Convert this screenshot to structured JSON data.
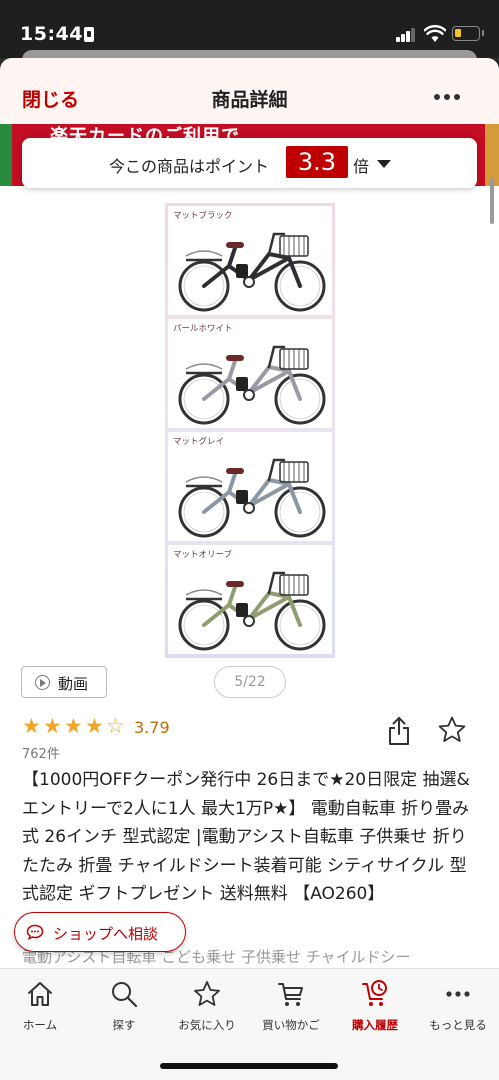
{
  "status_bar": {
    "time": "15:44"
  },
  "header": {
    "close_label": "閉じる",
    "title": "商品詳細"
  },
  "banner": {
    "text": "楽天カードのご利用で"
  },
  "point": {
    "text": "今この商品はポイント",
    "multiplier": "3.3",
    "unit": "倍"
  },
  "gallery": {
    "variants": [
      "マットブラック",
      "パールホワイト",
      "マットグレイ",
      "マットオリーブ"
    ],
    "variant_colors": [
      "#2d2e33",
      "#e8e8ec",
      "#8b98a3",
      "#8f9e6e"
    ],
    "video_label": "動画",
    "pager": "5/22"
  },
  "rating": {
    "value": "3.79",
    "stars": 4,
    "max": 5,
    "count": "762件"
  },
  "product": {
    "title": "【1000円OFFクーポン発行中 26日まで★20日限定 抽選&エントリーで2人に1人 最大1万P★】 電動自転車 折り畳み式 26インチ 型式認定 |電動アシスト自転車 子供乗せ 折りたたみ 折畳 チャイルドシート装着可能 シティサイクル 型式認定 ギフト",
    "title_cont": "プレゼント 送料無料 【AO260】",
    "tags": "電動アシスト自転車 こども乗せ 子供乗せ チャイルドシー"
  },
  "consult": {
    "label": "ショップへ相談"
  },
  "bottom_nav": {
    "items": [
      {
        "label": "ホーム",
        "icon": "home-icon"
      },
      {
        "label": "探す",
        "icon": "search-icon"
      },
      {
        "label": "お気に入り",
        "icon": "star-icon"
      },
      {
        "label": "買い物かご",
        "icon": "cart-icon"
      },
      {
        "label": "購入履歴",
        "icon": "history-icon"
      },
      {
        "label": "もっと見る",
        "icon": "more-icon"
      }
    ],
    "active_index": 4
  },
  "colors": {
    "brand_red": "#bf0000",
    "star": "#f2a627"
  }
}
